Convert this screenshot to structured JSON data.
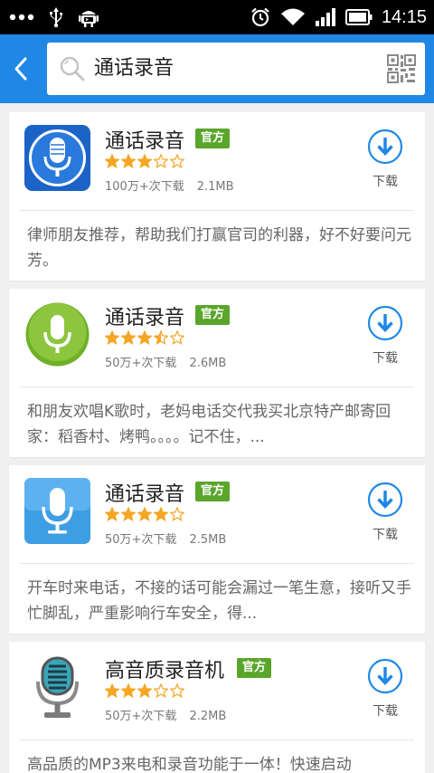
{
  "status_bar": {
    "time": "14:15",
    "icons": [
      "more-dots-icon",
      "usb-icon",
      "android-debug-icon",
      "alarm-icon",
      "wifi-icon",
      "signal-icon",
      "battery-icon"
    ]
  },
  "search": {
    "query": "通话录音"
  },
  "apps": [
    {
      "name": "通话录音",
      "badge": "官方",
      "rating": 3,
      "downloads": "100万+次下载",
      "size": "2.1MB",
      "download_label": "下载",
      "description": "律师朋友推荐，帮助我们打赢官司的利器，好不好要问元芳。"
    },
    {
      "name": "通话录音",
      "badge": "官方",
      "rating": 3.5,
      "downloads": "50万+次下载",
      "size": "2.6MB",
      "download_label": "下载",
      "description": "和朋友欢唱K歌时，老妈电话交代我买北京特产邮寄回家：稻香村、烤鸭。。。。记不住，..."
    },
    {
      "name": "通话录音",
      "badge": "官方",
      "rating": 4,
      "downloads": "50万+次下载",
      "size": "2.5MB",
      "download_label": "下载",
      "description": "开车时来电话，不接的话可能会漏过一笔生意，接听又手忙脚乱，严重影响行车安全，得..."
    },
    {
      "name": "高音质录音机",
      "badge": "官方",
      "rating": 3,
      "downloads": "50万+次下载",
      "size": "2.2MB",
      "download_label": "下载",
      "description": "高品质的MP3来电和录音功能于一体！快速启动"
    }
  ],
  "colors": {
    "app_bar": "#1f88e5",
    "badge": "#5aa52b",
    "star": "#f5a623",
    "download": "#1f88e5"
  }
}
